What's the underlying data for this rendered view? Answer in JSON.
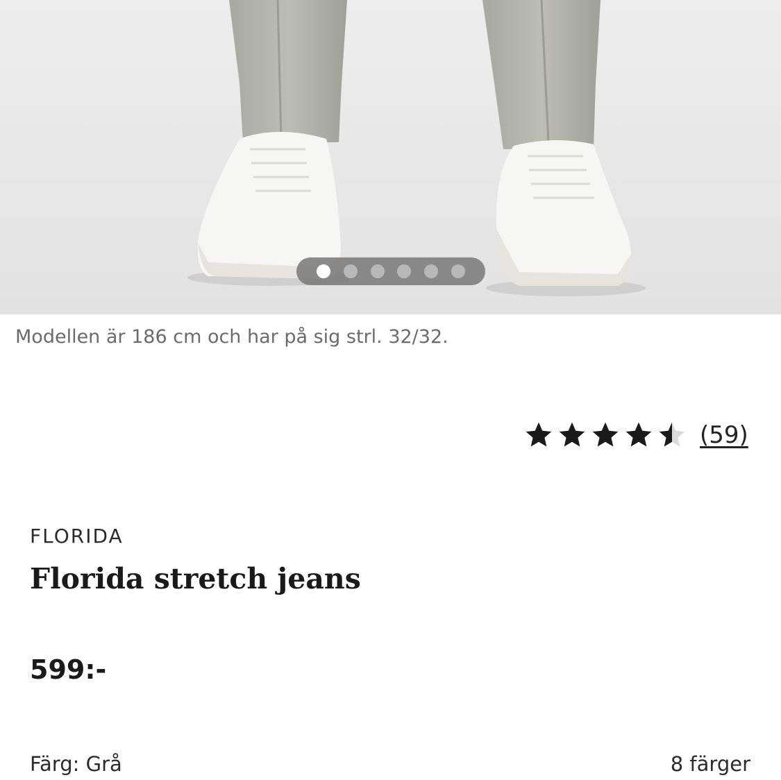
{
  "gallery": {
    "image_alt": "Model wearing grey stretch jeans with white sneakers",
    "slide_count": 6,
    "active_slide": 1,
    "caption": "Modellen är 186 cm och har på sig strl. 32/32."
  },
  "rating": {
    "value": 4.5,
    "max": 5,
    "count_label": "(59)",
    "star_color": "#1a1a1a",
    "empty_color": "#dcdcdc"
  },
  "product": {
    "brand": "FLORIDA",
    "name": "Florida stretch jeans",
    "price": "599:-"
  },
  "color": {
    "label": "Färg: Grå",
    "options_count": "8 färger"
  }
}
